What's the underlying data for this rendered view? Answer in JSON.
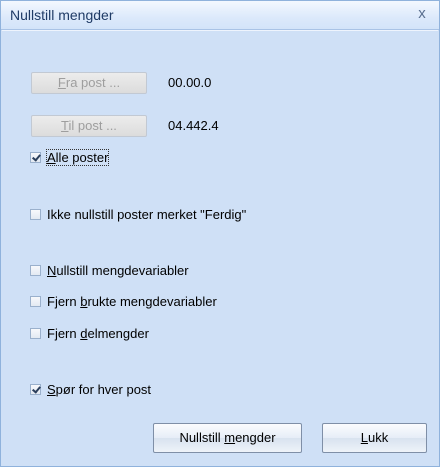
{
  "window": {
    "title": "Nullstill mengder",
    "close_glyph": "x"
  },
  "range": {
    "from_button": {
      "label_u": "F",
      "label_rest": "ra post ..."
    },
    "from_value": "00.00.0",
    "to_button": {
      "label_u": "T",
      "label_rest": "il post ..."
    },
    "to_value": "04.442.4"
  },
  "options": {
    "all_posts": {
      "label_u": "A",
      "label_rest": "lle poster",
      "checked": true
    },
    "skip_done": {
      "label": "Ikke nullstill poster merket \"Ferdig\"",
      "checked": false
    },
    "reset_vars": {
      "label_u": "N",
      "label_rest": "ullstill mengdevariabler",
      "checked": false
    },
    "remove_used": {
      "label_pre": "Fjern ",
      "label_u": "b",
      "label_rest": "rukte mengdevariabler",
      "checked": false
    },
    "remove_sub": {
      "label_pre": "Fjern ",
      "label_u": "d",
      "label_rest": "elmengder",
      "checked": false
    },
    "ask_each": {
      "label_u": "S",
      "label_rest": "pør for hver post",
      "checked": true
    }
  },
  "actions": {
    "reset": {
      "label_pre": "Nullstill ",
      "label_u": "m",
      "label_rest": "engder"
    },
    "close": {
      "label_u": "L",
      "label_rest": "ukk"
    }
  }
}
